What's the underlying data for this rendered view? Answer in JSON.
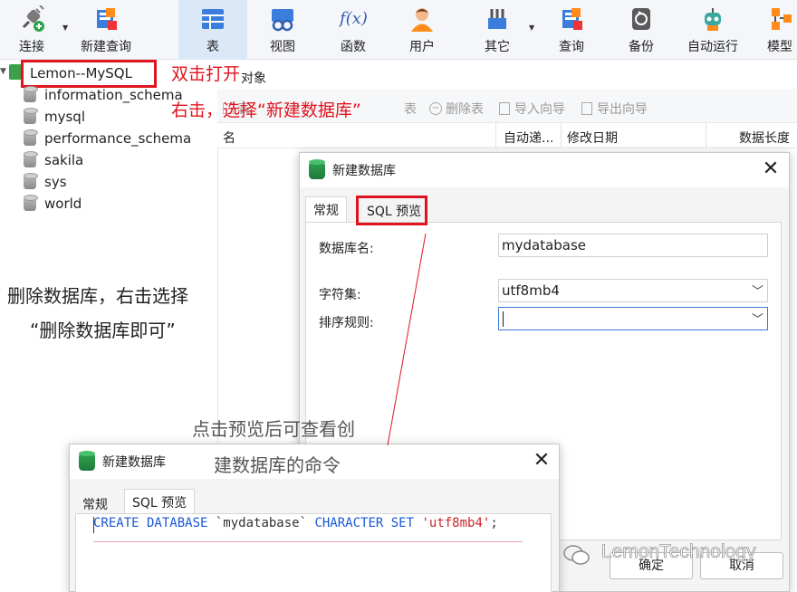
{
  "toolbar": {
    "items": [
      {
        "label": "连接",
        "icon": "plug-icon"
      },
      {
        "label": "新建查询",
        "icon": "new-query-icon"
      },
      {
        "label": "表",
        "icon": "table-icon"
      },
      {
        "label": "视图",
        "icon": "view-icon"
      },
      {
        "label": "函数",
        "icon": "function-icon"
      },
      {
        "label": "用户",
        "icon": "user-icon"
      },
      {
        "label": "其它",
        "icon": "tools-icon"
      },
      {
        "label": "查询",
        "icon": "query-icon"
      },
      {
        "label": "备份",
        "icon": "backup-icon"
      },
      {
        "label": "自动运行",
        "icon": "robot-icon"
      },
      {
        "label": "模型",
        "icon": "model-icon"
      }
    ],
    "function_glyph": "f(x)"
  },
  "tree": {
    "connection": "Lemon--MySQL",
    "databases": [
      "information_schema",
      "mysql",
      "performance_schema",
      "sakila",
      "sys",
      "world"
    ]
  },
  "object_tab": "对象",
  "sub_toolbar": {
    "partial_label": "表",
    "new_table": "表",
    "delete_table": "删除表",
    "import_wizard": "导入向导",
    "export_wizard": "导出向导"
  },
  "columns": [
    "名",
    "自动递...",
    "修改日期",
    "数据长度"
  ],
  "dialog_main": {
    "title": "新建数据库",
    "tabs": [
      "常规",
      "SQL 预览"
    ],
    "fields": {
      "db_name_label": "数据库名:",
      "db_name_value": "mydatabase",
      "charset_label": "字符集:",
      "charset_value": "utf8mb4",
      "collation_label": "排序规则:",
      "collation_value": ""
    },
    "ok_button": "确定",
    "cancel_button": "取消"
  },
  "dialog_preview": {
    "title": "新建数据库",
    "tabs": [
      "常规",
      "SQL 预览"
    ],
    "sql": {
      "kw1": "CREATE DATABASE",
      "name": " `mydatabase` ",
      "kw2": "CHARACTER SET",
      "value": " 'utf8mb4'",
      "end": ";"
    }
  },
  "annotations": {
    "double_click": "双击打开",
    "right_click": "右击，选择“新建数据库”",
    "delete_line1": "删除数据库，右击选择",
    "delete_line2": "“删除数据库即可”",
    "preview_line1": "点击预览后可查看创",
    "preview_line2": "建数据库的命令"
  },
  "watermark": "LemonTechnology",
  "colors": {
    "annotation_red": "#e0141e",
    "sql_keyword": "#1a57d6",
    "sql_string": "#c8252b",
    "db_icon_green": "#2ea44f"
  }
}
